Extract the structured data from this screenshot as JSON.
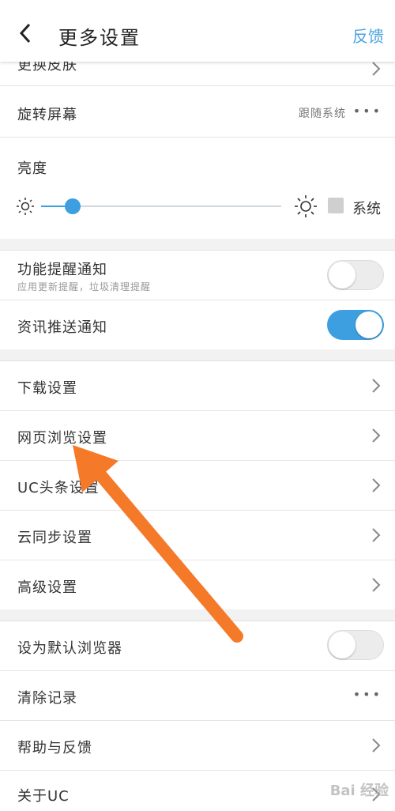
{
  "header": {
    "title": "更多设置",
    "feedback_label": "反馈"
  },
  "section1": {
    "skin_label": "更换皮肤",
    "rotate_label": "旋转屏幕",
    "rotate_value": "跟随系统",
    "dots": "•••",
    "brightness_label": "亮度",
    "brightness_level": 0.13,
    "system_label": "系统"
  },
  "section2": {
    "feature_notify_label": "功能提醒通知",
    "feature_notify_sub": "应用更新提醒，垃圾清理提醒",
    "feature_notify_on": false,
    "news_push_label": "资讯推送通知",
    "news_push_on": true
  },
  "section3": {
    "items": [
      {
        "label": "下载设置"
      },
      {
        "label": "网页浏览设置"
      },
      {
        "label": "UC头条设置"
      },
      {
        "label": "云同步设置"
      },
      {
        "label": "高级设置"
      }
    ]
  },
  "section4": {
    "default_browser_label": "设为默认浏览器",
    "default_browser_on": false,
    "clear_label": "清除记录",
    "dots": "•••",
    "help_label": "帮助与反馈",
    "about_label": "关于UC"
  },
  "watermark": "Bai 经验",
  "colors": {
    "accent": "#3d9ee0",
    "arrow": "#f47a2a"
  }
}
